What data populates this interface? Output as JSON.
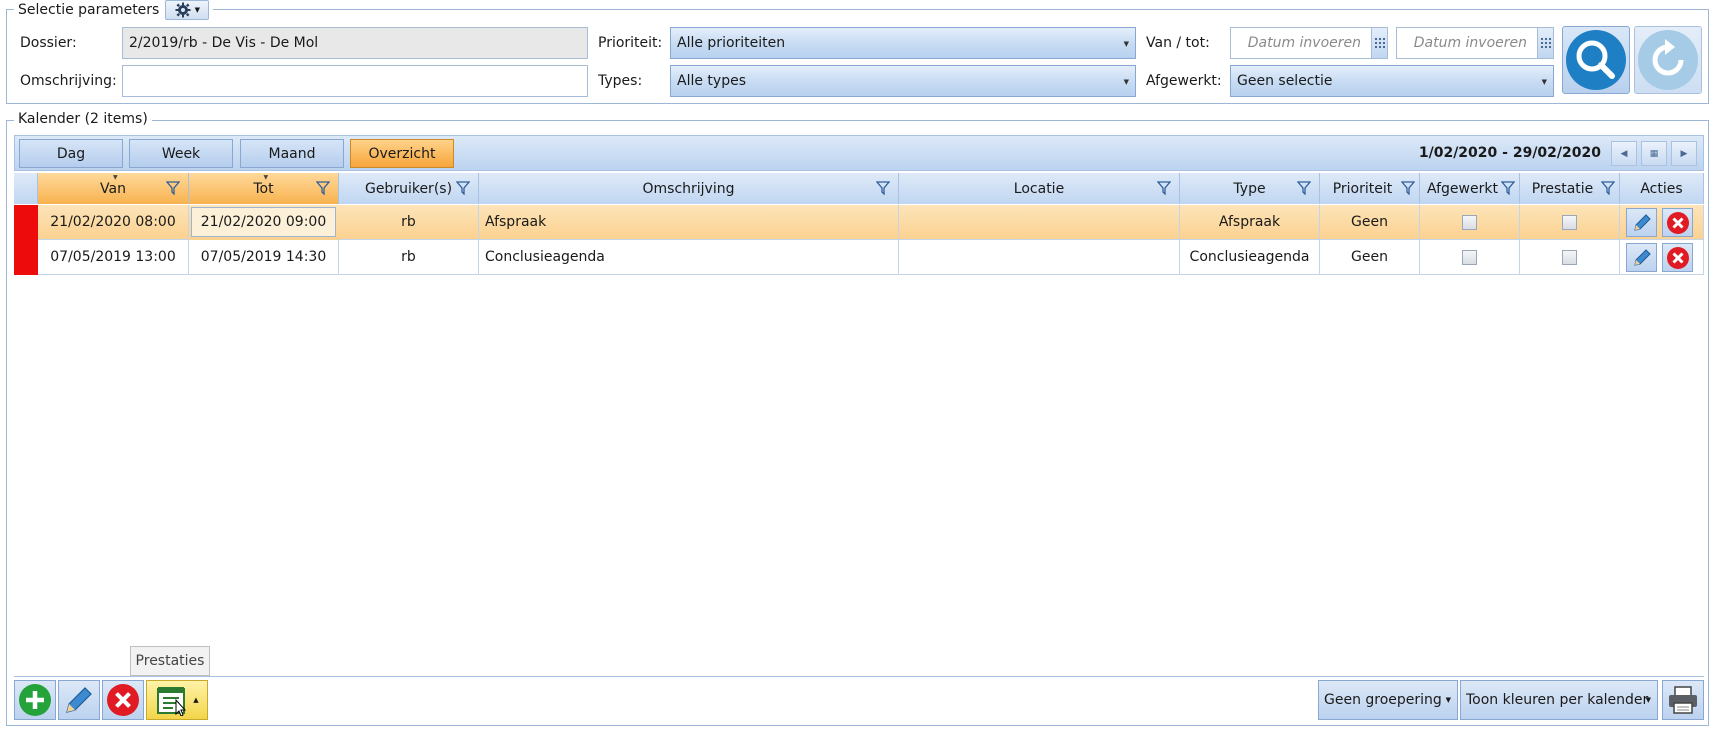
{
  "selection": {
    "legend": "Selectie parameters",
    "dossier_label": "Dossier:",
    "dossier_value": "2/2019/rb - De Vis - De Mol",
    "omschrijving_label": "Omschrijving:",
    "omschrijving_value": "",
    "prioriteit_label": "Prioriteit:",
    "prioriteit_value": "Alle prioriteiten",
    "types_label": "Types:",
    "types_value": "Alle types",
    "vantot_label": "Van / tot:",
    "van_placeholder": "Datum invoeren",
    "tot_placeholder": "Datum invoeren",
    "afgewerkt_label": "Afgewerkt:",
    "afgewerkt_value": "Geen selectie"
  },
  "calendar": {
    "legend": "Kalender (2 items)",
    "views": [
      "Dag",
      "Week",
      "Maand",
      "Overzicht"
    ],
    "active_view": "Overzicht",
    "date_range": "1/02/2020 - 29/02/2020"
  },
  "grid": {
    "columns": [
      "Van",
      "Tot",
      "Gebruiker(s)",
      "Omschrijving",
      "Locatie",
      "Type",
      "Prioriteit",
      "Afgewerkt",
      "Prestatie",
      "Acties"
    ],
    "rows": [
      {
        "van": "21/02/2020 08:00",
        "tot": "21/02/2020 09:00",
        "gebruiker": "rb",
        "omschrijving": "Afspraak",
        "locatie": "",
        "type": "Afspraak",
        "prioriteit": "Geen",
        "afgewerkt": false,
        "prestatie": false
      },
      {
        "van": "07/05/2019 13:00",
        "tot": "07/05/2019 14:30",
        "gebruiker": "rb",
        "omschrijving": "Conclusieagenda",
        "locatie": "",
        "type": "Conclusieagenda",
        "prioriteit": "Geen",
        "afgewerkt": false,
        "prestatie": false
      }
    ]
  },
  "footer": {
    "tooltip": "Prestaties",
    "grouping": "Geen groepering",
    "colors": "Toon kleuren per kalender"
  },
  "colors": {
    "accent_blue": "#1e7fc4",
    "row_marker_red": "#ee0b0b",
    "selected_orange": "#f7a53a"
  }
}
